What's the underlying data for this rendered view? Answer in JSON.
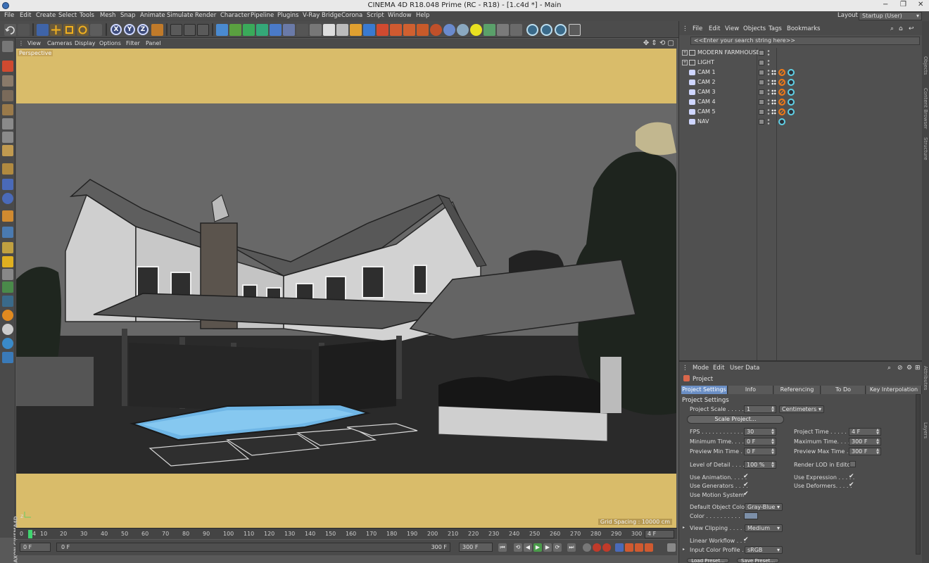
{
  "title": "CINEMA 4D R18.048 Prime (RC - R18) - [1.c4d *] - Main",
  "window_controls": [
    "−",
    "❐",
    "✕"
  ],
  "menu": [
    "File",
    "Edit",
    "Create",
    "Select",
    "Tools",
    "Mesh",
    "Snap",
    "Animate",
    "Simulate",
    "Render",
    "Character",
    "Pipeline",
    "Plugins",
    "V-Ray Bridge",
    "Corona",
    "Script",
    "Window",
    "Help"
  ],
  "layout": {
    "label": "Layout:",
    "value": "Startup (User)"
  },
  "toolbar": {
    "axes": [
      "X",
      "Y",
      "Z"
    ]
  },
  "viewport": {
    "menu": [
      "View",
      "Cameras",
      "Display",
      "Options",
      "Filter",
      "Panel"
    ],
    "nav_icons": "✥ ⇕ ⟲ ▢",
    "label": "Perspective",
    "grid_spacing": "Grid Spacing : 10000 cm",
    "gizmo": "z"
  },
  "timeline": {
    "ticks": [
      "0",
      "4",
      "10",
      "20",
      "30",
      "40",
      "50",
      "60",
      "70",
      "80",
      "90",
      "100",
      "110",
      "120",
      "130",
      "140",
      "150",
      "160",
      "170",
      "180",
      "190",
      "200",
      "210",
      "220",
      "230",
      "240",
      "250",
      "260",
      "270",
      "280",
      "290",
      "300"
    ],
    "current": "4 F",
    "field_left": "0 F",
    "field_mid": "0 F",
    "field_end": "300 F",
    "field_max": "300 F"
  },
  "transport": [
    "⏮",
    "⟲",
    "◀",
    "▶",
    "▶",
    "⟳",
    "⏭"
  ],
  "logo": "MAXON CINEMA4D",
  "object_manager": {
    "menu": [
      "File",
      "Edit",
      "View",
      "Objects",
      "Tags",
      "Bookmarks"
    ],
    "search_placeholder": "<<Enter your search string here>>",
    "objects": [
      {
        "name": "MODERN FARMHOUSE",
        "kind": "null",
        "expand": "+"
      },
      {
        "name": "LIGHT",
        "kind": "null",
        "expand": "+"
      },
      {
        "name": "CAM 1",
        "kind": "camera"
      },
      {
        "name": "CAM 2",
        "kind": "camera"
      },
      {
        "name": "CAM 3",
        "kind": "camera"
      },
      {
        "name": "CAM 4",
        "kind": "camera"
      },
      {
        "name": "CAM 5",
        "kind": "camera"
      },
      {
        "name": "NAV",
        "kind": "camera"
      }
    ]
  },
  "side_tabs": [
    "Objects",
    "Content Browser",
    "Structure"
  ],
  "side_tabs_lower": [
    "Attributes",
    "Layers"
  ],
  "attributes": {
    "menu": [
      "Mode",
      "Edit",
      "User Data"
    ],
    "header": "Project",
    "tabs": [
      "Project Settings",
      "Info",
      "Referencing",
      "To Do",
      "Key Interpolation"
    ],
    "active_tab": "Project Settings",
    "section": "Project Settings",
    "project_scale_label": "Project Scale . . . . . .",
    "project_scale_value": "1",
    "project_scale_unit": "Centimeters",
    "scale_button": "Scale Project...",
    "fps_label": "FPS . . . . . . . . . . . . .",
    "fps": "30",
    "project_time_label": "Project Time . . . . . .",
    "project_time": "4 F",
    "min_time_label": "Minimum Time. . . . . .",
    "min_time": "0 F",
    "max_time_label": "Maximum Time. . . . . .",
    "max_time": "300 F",
    "prev_min_label": "Preview Min Time . . .",
    "prev_min": "0 F",
    "prev_max_label": "Preview Max Time . . .",
    "prev_max": "300 F",
    "lod_label": "Level of Detail . . . . .",
    "lod": "100 %",
    "render_lod_label": "Render LOD in Editor",
    "use_animation": "Use Animation. . . . .",
    "use_expression": "Use Expression . . . . .",
    "use_generators": "Use Generators . . . .",
    "use_deformers": "Use Deformers. . . . .",
    "use_motion": "Use Motion System",
    "default_color_label": "Default Object Color",
    "default_color": "Gray-Blue",
    "color_label": "Color . . . . . . . . . .",
    "view_clipping_label": "View Clipping . . . . .",
    "view_clipping": "Medium",
    "linear_workflow_label": "Linear Workflow . . .",
    "input_profile_label": "Input Color Profile . .",
    "input_profile": "sRGB",
    "load_preset": "Load Preset...",
    "save_preset": "Save Preset..."
  },
  "colors": {
    "accent": "#6b8fc5",
    "viewport_bg": "#d9bc6a",
    "playhead": "#3fd46f"
  }
}
